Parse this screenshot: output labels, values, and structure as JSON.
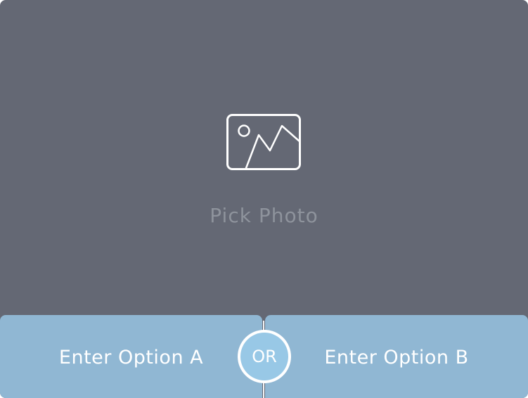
{
  "photo_picker": {
    "icon": "image-icon",
    "label": "Pick Photo"
  },
  "options": {
    "a": {
      "label": "Enter Option A"
    },
    "b": {
      "label": "Enter Option B"
    },
    "separator": {
      "label": "OR"
    }
  },
  "colors": {
    "background": "#646874",
    "photo_label": "#8e939c",
    "option_background": "#90b7d3",
    "or_background": "#98c8e6",
    "white": "#ffffff"
  }
}
